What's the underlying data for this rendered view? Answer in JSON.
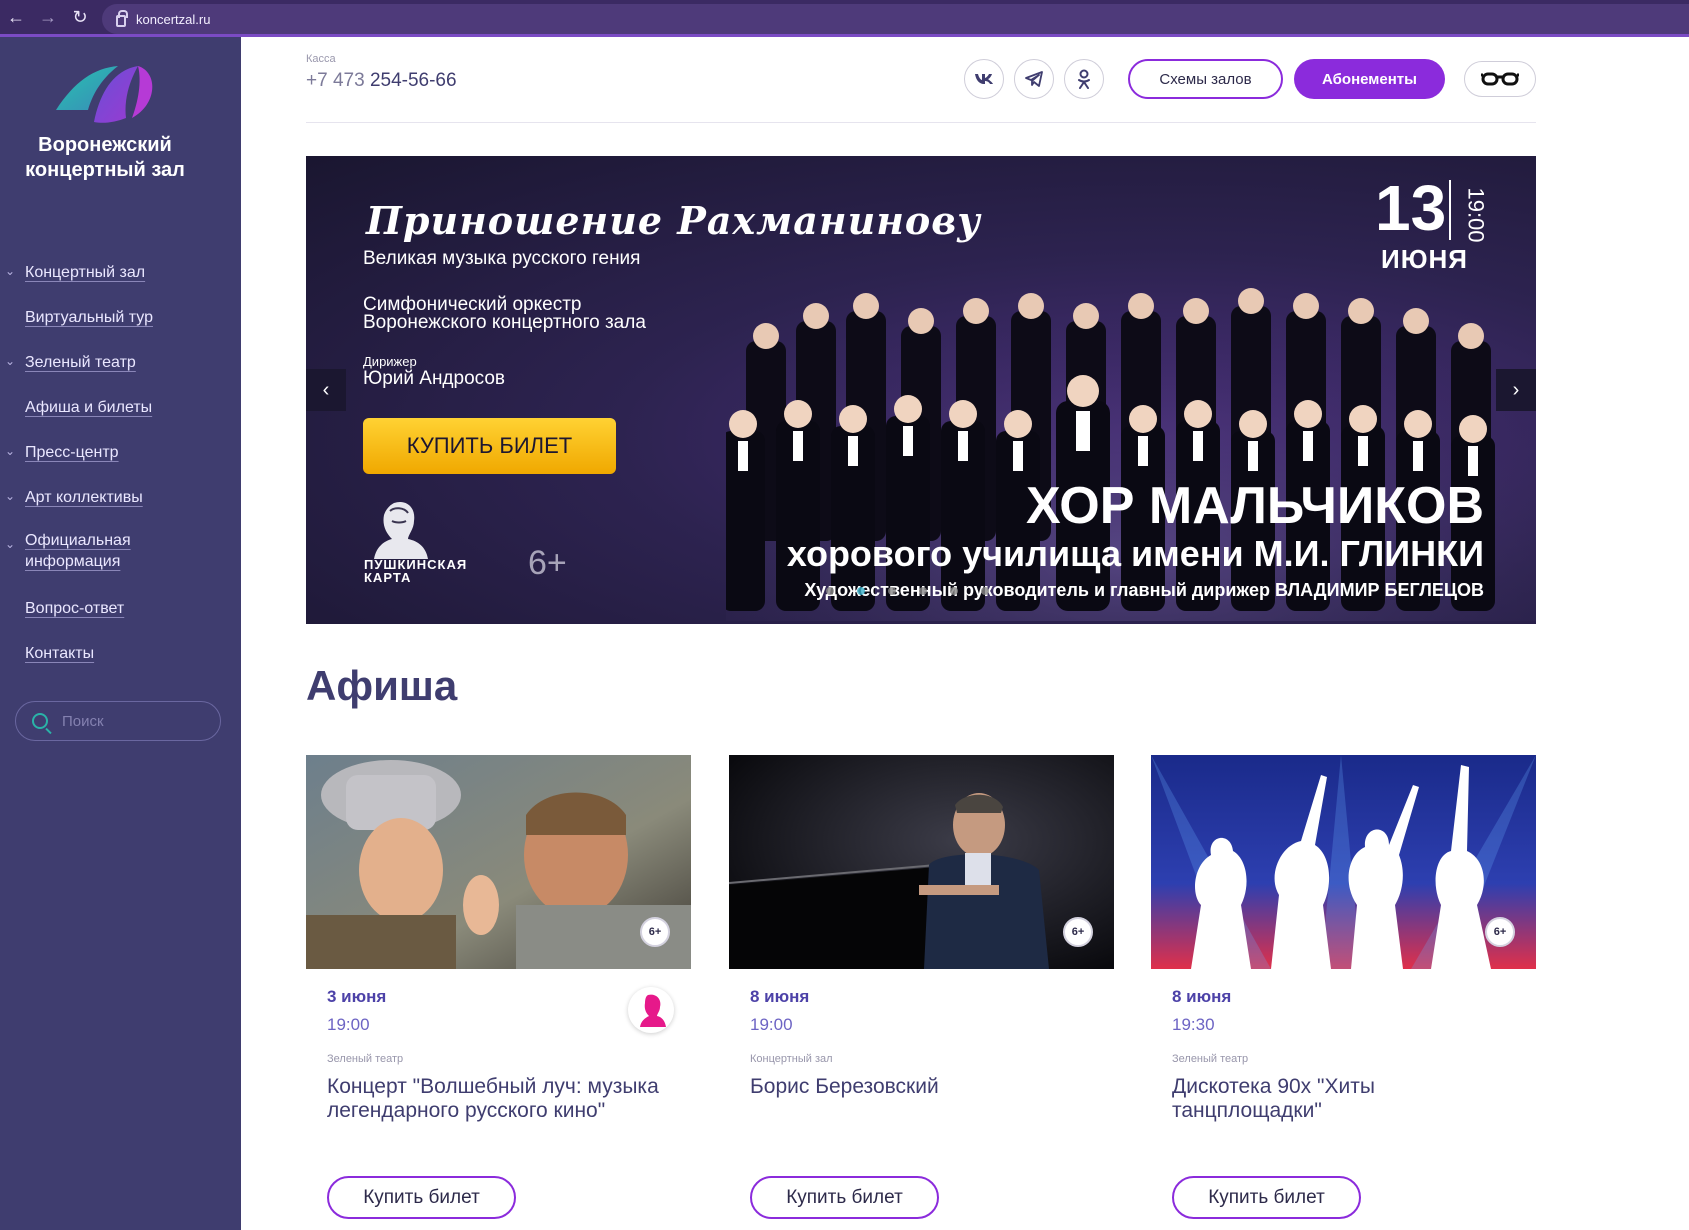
{
  "browser": {
    "url": "koncertzal.ru"
  },
  "sidebar": {
    "brand": "Воронежский концертный зал",
    "items": [
      {
        "label": "Концертный зал",
        "expandable": true
      },
      {
        "label": "Виртуальный тур",
        "expandable": false
      },
      {
        "label": "Зеленый театр",
        "expandable": true
      },
      {
        "label": "Афиша и билеты",
        "expandable": false
      },
      {
        "label": "Пресс-центр",
        "expandable": true
      },
      {
        "label": "Арт коллективы",
        "expandable": true
      },
      {
        "label": "Официальная информация",
        "expandable": true
      },
      {
        "label": "Вопрос-ответ",
        "expandable": false
      },
      {
        "label": "Контакты",
        "expandable": false
      }
    ],
    "search_placeholder": "Поиск"
  },
  "header": {
    "kassa_label": "Касса",
    "phone_prefix": "+7 473",
    "phone_number": "254-56-66",
    "social": [
      "vk-icon",
      "telegram-icon",
      "odnoklassniki-icon"
    ],
    "schemes_label": "Схемы залов",
    "subscriptions_label": "Абонементы",
    "accessibility_icon": "glasses-icon"
  },
  "hero": {
    "title": "Приношение Рахманинову",
    "subtitle": "Великая музыка русского гения",
    "orchestra": "Симфонический оркестр Воронежского концертного зала",
    "conductor_label": "Дирижер",
    "conductor": "Юрий Андросов",
    "buy_label": "КУПИТЬ БИЛЕТ",
    "pushkin_card": "ПУШКИНСКАЯ КАРТА",
    "age": "6+",
    "date_day": "13",
    "date_time": "19:00",
    "date_month": "ИЮНЯ",
    "headline": "ХОР МАЛЬЧИКОВ",
    "headline2": "хорового училища имени М.И. ГЛИНКИ",
    "headline3": "Художественный руководитель и главный дирижер ВЛАДИМИР БЕГЛЕЦОВ",
    "slide_count": 6,
    "active_slide": 2
  },
  "afisha": {
    "title": "Афиша",
    "cards": [
      {
        "date": "3 июня",
        "time": "19:00",
        "venue": "Зеленый театр",
        "title": "Концерт \"Волшебный луч: музыка легендарного русского кино\"",
        "age": "6+",
        "buy_label": "Купить билет",
        "pushkin": true
      },
      {
        "date": "8 июня",
        "time": "19:00",
        "venue": "Концертный зал",
        "title": "Борис Березовский",
        "age": "6+",
        "buy_label": "Купить билет",
        "pushkin": false
      },
      {
        "date": "8 июня",
        "time": "19:30",
        "venue": "Зеленый театр",
        "title": "Дискотека 90х \"Хиты танцплощадки\"",
        "age": "6+",
        "buy_label": "Купить билет",
        "pushkin": false
      }
    ]
  },
  "colors": {
    "sidebar": "#3f3d6f",
    "accent": "#8b2bdc",
    "browser": "#3b2a63",
    "buy_yellow": "#ffc21a"
  }
}
